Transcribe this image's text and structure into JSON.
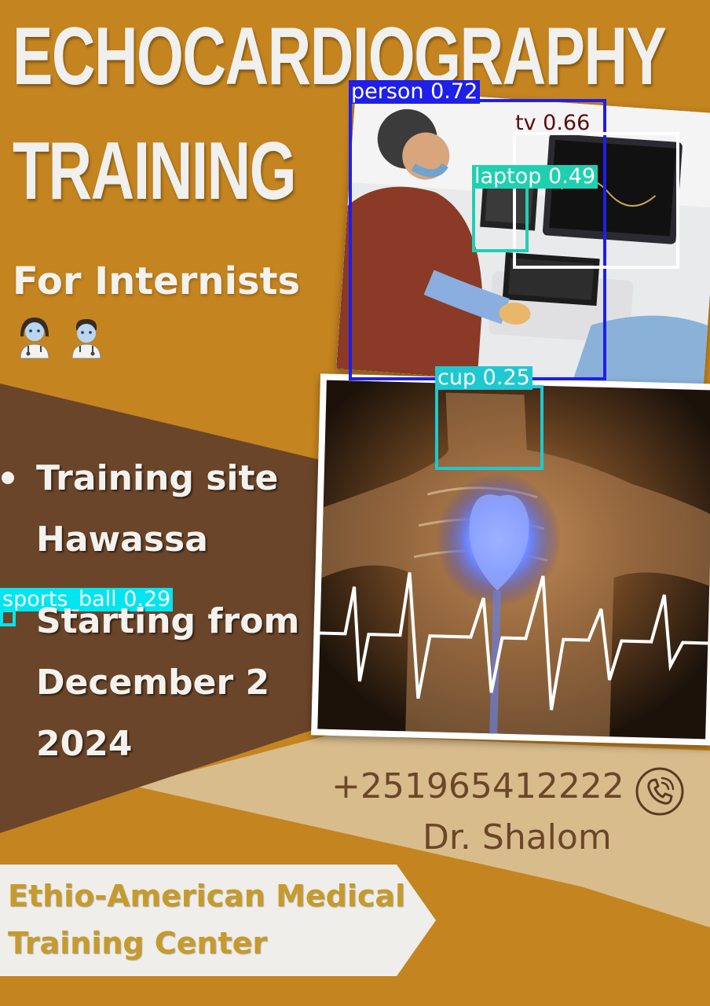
{
  "title_line1": "ECHOCARDIOGRAPHY",
  "title_line2": "TRAINING",
  "subtitle": "For Internists",
  "emoji_icons": [
    "woman-health-worker-icon",
    "man-health-worker-icon"
  ],
  "bullets": [
    {
      "line1": "Training site",
      "line2": "Hawassa"
    },
    {
      "line1": "Starting from",
      "line2": "December 2",
      "line3": "2024"
    }
  ],
  "contact": {
    "phone": "+251965412222",
    "name": "Dr. Shalom",
    "icon": "phone-icon"
  },
  "organization": {
    "line1": "Ethio-American Medical",
    "line2": "Training Center"
  },
  "detections": [
    {
      "label": "person 0.72",
      "color": "#1f1fe8"
    },
    {
      "label": "tv 0.66",
      "color": "#ffffff"
    },
    {
      "label": "laptop 0.49",
      "color": "#1fd0b0"
    },
    {
      "label": "cup 0.25",
      "color": "#1fc8d0"
    },
    {
      "label": "sports_ball 0.29",
      "color": "#00e5f0"
    }
  ],
  "colors": {
    "background": "#c4841f",
    "dark_brown": "#6b4529",
    "beige": "#d9bc8c",
    "cream": "#efeeea"
  }
}
